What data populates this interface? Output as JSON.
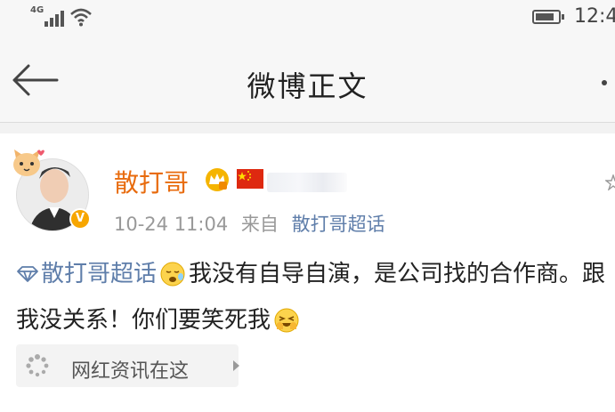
{
  "status_bar": {
    "network": "4G",
    "time": "12:4"
  },
  "nav": {
    "title": "微博正文"
  },
  "post": {
    "username": "散打哥",
    "time": "10-24 11:04",
    "source_prefix": "来自",
    "source": "散打哥超话",
    "topic": "散打哥超话",
    "text_part1": "我没有自导自演，是公司找的合作商。跟我没关系！你们要笑死我"
  },
  "card": {
    "label": "网红资讯在这"
  },
  "colors": {
    "username": "#e86b0d",
    "link": "#5f7eaa",
    "verified_badge": "#f7a600"
  },
  "icons": [
    "signal-icon",
    "wifi-icon",
    "battery-icon",
    "back-arrow-icon",
    "more-icon",
    "cat-pendant-icon",
    "verified-v-icon",
    "crown-badge-icon",
    "china-flag-icon",
    "diamond-topic-icon",
    "sleepy-emoji-icon",
    "laugh-emoji-icon",
    "loading-spinner-icon",
    "chevron-right-icon"
  ]
}
